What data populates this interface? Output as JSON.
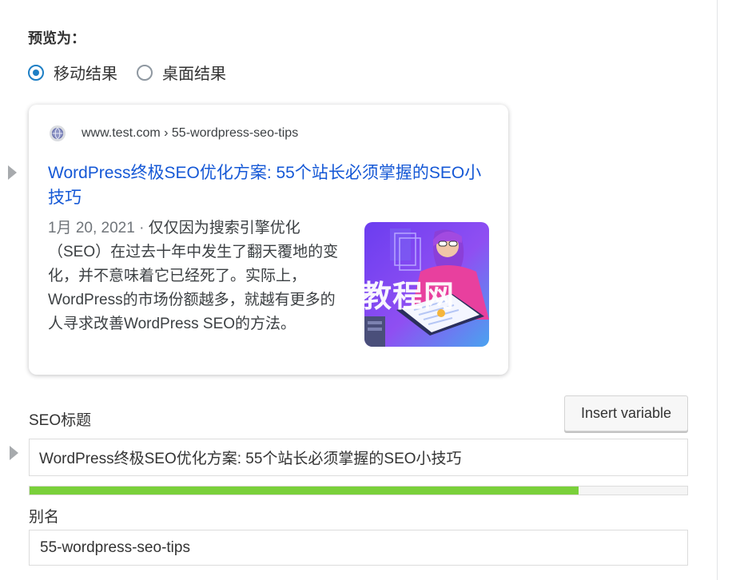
{
  "preview": {
    "label": "预览为：",
    "options": [
      {
        "label": "移动结果",
        "checked": true
      },
      {
        "label": "桌面结果",
        "checked": false
      }
    ]
  },
  "serp": {
    "url": "www.test.com › 55-wordpress-seo-tips",
    "title": "WordPress终极SEO优化方案: 55个站长必须掌握的SEO小技巧",
    "date": "1月 20, 2021",
    "separator": " · ",
    "snippet": "仅仅因为搜索引擎优化（SEO）在过去十年中发生了翻天覆地的变化，并不意味着它已经死了。实际上，WordPress的市场份额越多，就越有更多的人寻求改善WordPress SEO的方法。",
    "thumbnail_icon": "illustration-woman-reading-document"
  },
  "watermark": "教程网",
  "seo_title": {
    "label": "SEO标题",
    "insert_button": "Insert variable",
    "value": "WordPress终极SEO优化方案: 55个站长必须掌握的SEO小技巧",
    "progress_percent": 83.5,
    "progress_color": "#7ad03a"
  },
  "slug": {
    "label": "别名",
    "value": "55-wordpress-seo-tips"
  },
  "colors": {
    "accent": "#1e7fc5",
    "link": "#1558d6"
  }
}
